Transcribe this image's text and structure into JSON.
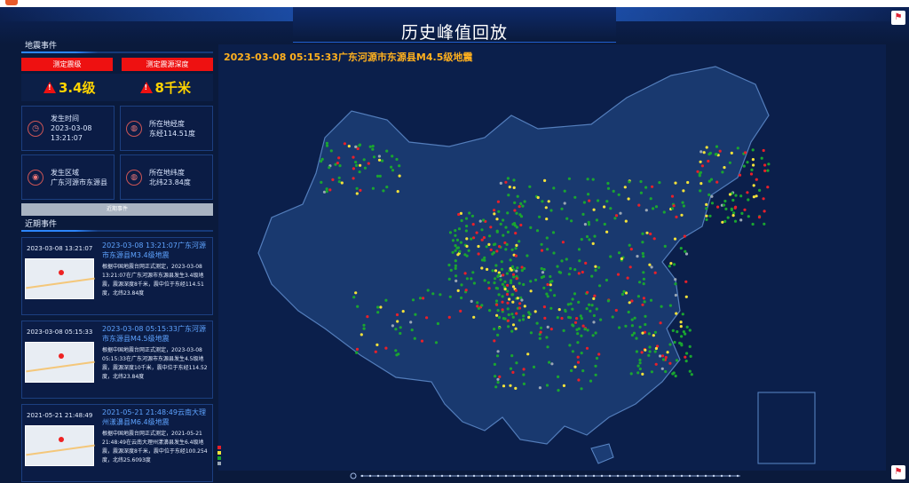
{
  "header": {
    "title": "历史峰值回放"
  },
  "left": {
    "section_event": "地震事件",
    "buttons": [
      "测定震级",
      "测定震源深度"
    ],
    "magnitude": "3.4级",
    "depth": "8千米",
    "info": [
      {
        "icon": "clock-icon",
        "label": "发生时间",
        "value1": "2023-03-08",
        "value2": "13:21:07"
      },
      {
        "icon": "globe-icon",
        "label": "所在地经度",
        "value1": "东经114.51度",
        "value2": ""
      },
      {
        "icon": "location-icon",
        "label": "发生区域",
        "value1": "广东河源市东源县",
        "value2": ""
      },
      {
        "icon": "globe-icon",
        "label": "所在地纬度",
        "value1": "北纬23.84度",
        "value2": ""
      }
    ],
    "gray_button": "近期事件",
    "section_recent": "近期事件",
    "events": [
      {
        "date": "2023-03-08 13:21:07",
        "headline": "2023-03-08 13:21:07广东河源市东源县M3.4级地震",
        "body": "根据中国地震台网正式测定，2023-03-08 13:21:07在广东河源市东源县发生3.4级地震，震源深度8千米，震中位于东经114.51度，北纬23.84度"
      },
      {
        "date": "2023-03-08 05:15:33",
        "headline": "2023-03-08 05:15:33广东河源市东源县M4.5级地震",
        "body": "根据中国地震台网正式测定，2023-03-08 05:15:33在广东河源市东源县发生4.5级地震，震源深度10千米，震中位于东经114.52度，北纬23.84度"
      },
      {
        "date": "2021-05-21 21:48:49",
        "headline": "2021-05-21 21:48:49云南大理州漾濞县M6.4级地震",
        "body": "根据中国地震台网正式测定，2021-05-21 21:48:49在云南大理州漾濞县发生6.4级地震，震源深度8千米，震中位于东经100.254度，北纬25.6093度"
      }
    ]
  },
  "map": {
    "heading": "2023-03-08 05:15:33广东河源市东源县M4.5级地震",
    "colors": {
      "red": "#e8202a",
      "yellow": "#f4e23a",
      "green": "#1aa530",
      "gray": "#9aa6b4"
    }
  }
}
